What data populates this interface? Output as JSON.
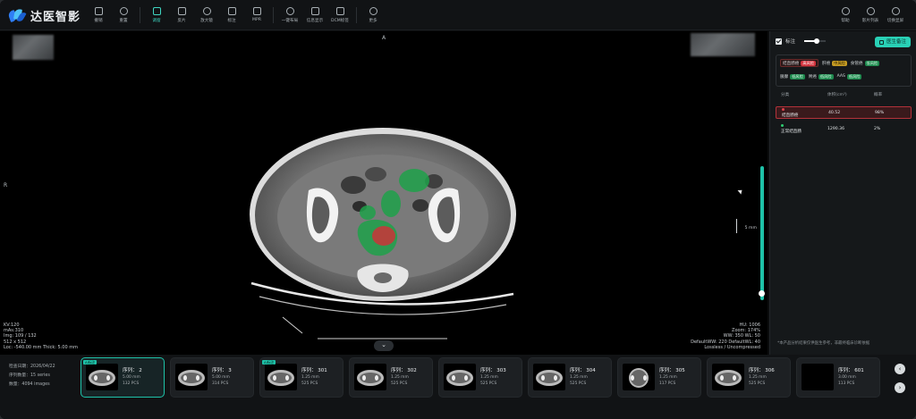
{
  "app": {
    "title": "达医智影"
  },
  "toolbar": {
    "items": [
      {
        "label": "撤销",
        "icon": "undo-icon"
      },
      {
        "label": "重置",
        "icon": "reset-icon"
      },
      {
        "label": "调窗",
        "icon": "window-level-icon",
        "active": true
      },
      {
        "label": "反片",
        "icon": "invert-icon"
      },
      {
        "label": "放大镜",
        "icon": "magnifier-icon"
      },
      {
        "label": "标注",
        "icon": "annotate-icon"
      },
      {
        "label": "MPR",
        "icon": "mpr-icon"
      },
      {
        "label": "一键布局",
        "icon": "layout-icon"
      },
      {
        "label": "信息显示",
        "icon": "info-icon"
      },
      {
        "label": "DCM标签",
        "icon": "dicom-tag-icon"
      },
      {
        "label": "更多",
        "icon": "more-icon"
      }
    ],
    "right_items": [
      {
        "label": "帮助",
        "icon": "help-icon"
      },
      {
        "label": "影片列表",
        "icon": "film-list-icon"
      },
      {
        "label": "切换显屏",
        "icon": "switch-screen-icon"
      }
    ]
  },
  "viewer": {
    "orientation": {
      "top": "A",
      "left": "R"
    },
    "overlay_bottom_left": [
      "KV:120",
      "mAs:310",
      "Img: 109 / 132",
      "512 x 512",
      "Loc: -540.00 mm Thick: 5.00 mm"
    ],
    "overlay_bottom_right": [
      "HU: 1006",
      "Zoom: 174%",
      "WW: 350 WL: 50",
      "DefaultWW: 220 DefaultWL: 40",
      "Lossless / Uncompressed"
    ],
    "scale_label": "5 mm",
    "expand_icon": "chevron-down-icon"
  },
  "panel": {
    "label_toggle": "标注",
    "opacity": 0.6,
    "doctor_button": "医生备注",
    "risk_rows": [
      [
        {
          "name": "结直肠癌",
          "level": "高风险",
          "severity": "high",
          "selected": true
        },
        {
          "name": "肝癌",
          "level": "中风险",
          "severity": "mid"
        },
        {
          "name": "食管癌",
          "level": "低风险",
          "severity": "low"
        }
      ],
      [
        {
          "name": "胰腺",
          "level": "低风险",
          "severity": "low"
        },
        {
          "name": "胃癌",
          "level": "低风险",
          "severity": "low"
        },
        {
          "name": "AAS",
          "level": "低风险",
          "severity": "low"
        }
      ]
    ],
    "table": {
      "headers": [
        "分类",
        "体积(cm³)",
        "概率"
      ],
      "rows": [
        {
          "name": "结直肠癌",
          "volume": "40.52",
          "prob": "98%",
          "color": "#e0404a",
          "highlight": true
        },
        {
          "name": "正常结直肠",
          "volume": "1290.36",
          "prob": "2%",
          "color": "#2ecc71",
          "highlight": false
        }
      ]
    },
    "note": "*本产品分析结果仅供医生参考，非最终临床诊断依据"
  },
  "study": {
    "date_label": "检查日期：",
    "date": "2026/04/22",
    "series_label": "序列数量：",
    "series": "15 series",
    "count_label": "数量：",
    "count": "4094 images"
  },
  "series_thumbs": [
    {
      "series": "序列： 2",
      "thickness": "5.00 mm",
      "count": "132 PCS",
      "ai": "AI标注",
      "selected": true
    },
    {
      "series": "序列： 3",
      "thickness": "5.00 mm",
      "count": "314 PCS"
    },
    {
      "series": "序列： 301",
      "thickness": "1.25 mm",
      "count": "525 PCS",
      "ai": "AI标注"
    },
    {
      "series": "序列： 302",
      "thickness": "1.25 mm",
      "count": "525 PCS"
    },
    {
      "series": "序列： 303",
      "thickness": "1.25 mm",
      "count": "525 PCS"
    },
    {
      "series": "序列： 304",
      "thickness": "1.25 mm",
      "count": "525 PCS"
    },
    {
      "series": "序列： 305",
      "thickness": "1.25 mm",
      "count": "117 PCS"
    },
    {
      "series": "序列： 306",
      "thickness": "1.25 mm",
      "count": "525 PCS"
    },
    {
      "series": "序列： 601",
      "thickness": "3.00 mm",
      "count": "113 PCS"
    }
  ],
  "nav": {
    "prev": "‹",
    "next": "›"
  }
}
